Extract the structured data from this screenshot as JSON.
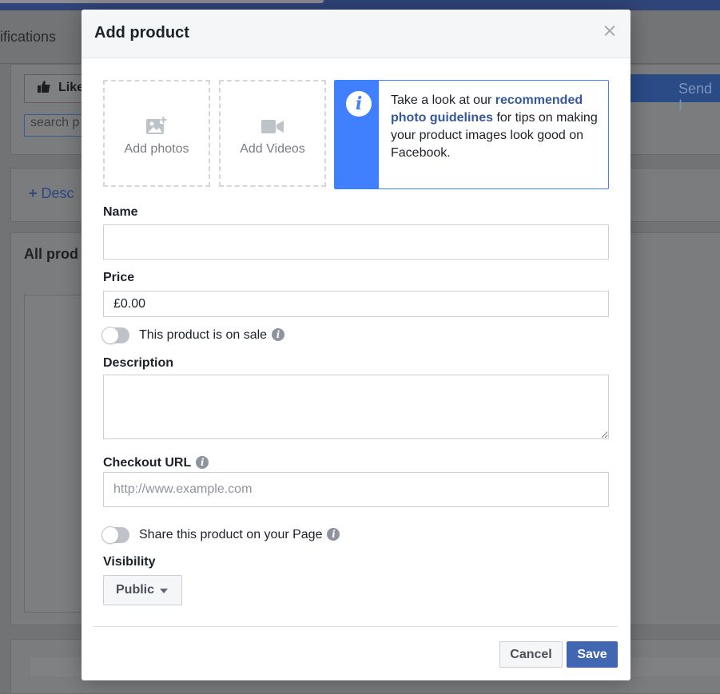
{
  "background": {
    "tab_text": "ifications",
    "like_label": "Like",
    "search_placeholder": "search p",
    "send_label": "Send I",
    "describe_label": "Desc",
    "all_products_label": "All prod"
  },
  "modal": {
    "title": "Add product",
    "media": {
      "photos_label": "Add photos",
      "videos_label": "Add Videos"
    },
    "tip": {
      "before": "Take a look at our ",
      "link": "recommended photo guidelines",
      "after": " for tips on making your product images look good on Facebook."
    },
    "name": {
      "label": "Name",
      "value": ""
    },
    "price": {
      "label": "Price",
      "value": "£0.00"
    },
    "on_sale": {
      "label": "This product is on sale",
      "checked": false
    },
    "description": {
      "label": "Description",
      "value": ""
    },
    "checkout_url": {
      "label": "Checkout URL",
      "value": "",
      "placeholder": "http://www.example.com"
    },
    "share": {
      "label": "Share this product on your Page",
      "checked": false
    },
    "visibility": {
      "label": "Visibility",
      "selected": "Public"
    },
    "buttons": {
      "cancel": "Cancel",
      "save": "Save"
    }
  },
  "colors": {
    "accent_blue": "#4080ff",
    "primary_button": "#4267b2",
    "link": "#365899"
  }
}
